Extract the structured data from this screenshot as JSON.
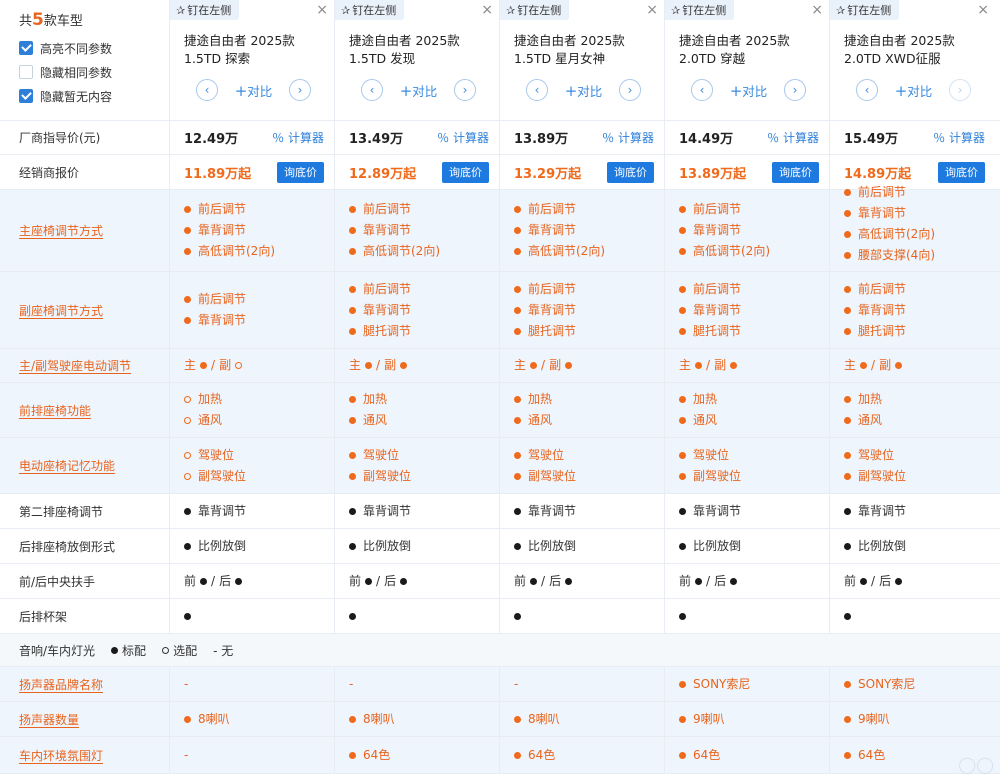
{
  "header": {
    "count_prefix": "共",
    "count": "5",
    "count_suffix": "款车型",
    "options": [
      {
        "label": "高亮不同参数",
        "checked": true
      },
      {
        "label": "隐藏相同参数",
        "checked": false
      },
      {
        "label": "隐藏暂无内容",
        "checked": true
      }
    ],
    "pin_label": "钉在左侧",
    "close_glyph": "×",
    "compare_label": "对比",
    "prev_glyph": "‹",
    "next_glyph": "›",
    "cars": [
      {
        "line1": "捷途自由者 2025款",
        "line2": "1.5TD 探索",
        "guide_price": "12.49万",
        "dealer_price": "11.89万起"
      },
      {
        "line1": "捷途自由者 2025款",
        "line2": "1.5TD 发现",
        "guide_price": "13.49万",
        "dealer_price": "12.89万起"
      },
      {
        "line1": "捷途自由者 2025款",
        "line2": "1.5TD 星月女神",
        "guide_price": "13.89万",
        "dealer_price": "13.29万起"
      },
      {
        "line1": "捷途自由者 2025款",
        "line2": "2.0TD 穿越",
        "guide_price": "14.49万",
        "dealer_price": "13.89万起"
      },
      {
        "line1": "捷途自由者 2025款",
        "line2": "2.0TD XWD征服",
        "guide_price": "15.49万",
        "dealer_price": "14.89万起"
      }
    ]
  },
  "labels": {
    "guide_price": "厂商指导价(元)",
    "dealer_price": "经销商报价",
    "calculator": "计算器",
    "ask_price": "询底价"
  },
  "rows": [
    {
      "label": "主座椅调节方式",
      "diff": true,
      "cells": [
        [
          {
            "m": "fo",
            "t": "前后调节"
          },
          {
            "m": "fo",
            "t": "靠背调节"
          },
          {
            "m": "fo",
            "t": "高低调节(2向)"
          }
        ],
        [
          {
            "m": "fo",
            "t": "前后调节"
          },
          {
            "m": "fo",
            "t": "靠背调节"
          },
          {
            "m": "fo",
            "t": "高低调节(2向)"
          }
        ],
        [
          {
            "m": "fo",
            "t": "前后调节"
          },
          {
            "m": "fo",
            "t": "靠背调节"
          },
          {
            "m": "fo",
            "t": "高低调节(2向)"
          }
        ],
        [
          {
            "m": "fo",
            "t": "前后调节"
          },
          {
            "m": "fo",
            "t": "靠背调节"
          },
          {
            "m": "fo",
            "t": "高低调节(2向)"
          }
        ],
        [
          {
            "m": "fo",
            "t": "前后调节"
          },
          {
            "m": "fo",
            "t": "靠背调节"
          },
          {
            "m": "fo",
            "t": "高低调节(2向)"
          },
          {
            "m": "fo",
            "t": "腰部支撑(4向)"
          }
        ]
      ]
    },
    {
      "label": "副座椅调节方式",
      "diff": true,
      "cells": [
        [
          {
            "m": "fo",
            "t": "前后调节"
          },
          {
            "m": "fo",
            "t": "靠背调节"
          }
        ],
        [
          {
            "m": "fo",
            "t": "前后调节"
          },
          {
            "m": "fo",
            "t": "靠背调节"
          },
          {
            "m": "fo",
            "t": "腿托调节"
          }
        ],
        [
          {
            "m": "fo",
            "t": "前后调节"
          },
          {
            "m": "fo",
            "t": "靠背调节"
          },
          {
            "m": "fo",
            "t": "腿托调节"
          }
        ],
        [
          {
            "m": "fo",
            "t": "前后调节"
          },
          {
            "m": "fo",
            "t": "靠背调节"
          },
          {
            "m": "fo",
            "t": "腿托调节"
          }
        ],
        [
          {
            "m": "fo",
            "t": "前后调节"
          },
          {
            "m": "fo",
            "t": "靠背调节"
          },
          {
            "m": "fo",
            "t": "腿托调节"
          }
        ]
      ]
    },
    {
      "label": "主/副驾驶座电动调节",
      "diff": true,
      "inline": true,
      "cells": [
        {
          "a": "主",
          "am": "fo",
          "b": "副",
          "bm": "ho"
        },
        {
          "a": "主",
          "am": "fo",
          "b": "副",
          "bm": "fo"
        },
        {
          "a": "主",
          "am": "fo",
          "b": "副",
          "bm": "fo"
        },
        {
          "a": "主",
          "am": "fo",
          "b": "副",
          "bm": "fo"
        },
        {
          "a": "主",
          "am": "fo",
          "b": "副",
          "bm": "fo"
        }
      ]
    },
    {
      "label": "前排座椅功能",
      "diff": true,
      "cells": [
        [
          {
            "m": "ho",
            "t": "加热"
          },
          {
            "m": "ho",
            "t": "通风"
          }
        ],
        [
          {
            "m": "fo",
            "t": "加热"
          },
          {
            "m": "fo",
            "t": "通风"
          }
        ],
        [
          {
            "m": "fo",
            "t": "加热"
          },
          {
            "m": "fo",
            "t": "通风"
          }
        ],
        [
          {
            "m": "fo",
            "t": "加热"
          },
          {
            "m": "fo",
            "t": "通风"
          }
        ],
        [
          {
            "m": "fo",
            "t": "加热"
          },
          {
            "m": "fo",
            "t": "通风"
          }
        ]
      ]
    },
    {
      "label": "电动座椅记忆功能",
      "diff": true,
      "cells": [
        [
          {
            "m": "ho",
            "t": "驾驶位"
          },
          {
            "m": "ho",
            "t": "副驾驶位"
          }
        ],
        [
          {
            "m": "fo",
            "t": "驾驶位"
          },
          {
            "m": "fo",
            "t": "副驾驶位"
          }
        ],
        [
          {
            "m": "fo",
            "t": "驾驶位"
          },
          {
            "m": "fo",
            "t": "副驾驶位"
          }
        ],
        [
          {
            "m": "fo",
            "t": "驾驶位"
          },
          {
            "m": "fo",
            "t": "副驾驶位"
          }
        ],
        [
          {
            "m": "fo",
            "t": "驾驶位"
          },
          {
            "m": "fo",
            "t": "副驾驶位"
          }
        ]
      ]
    },
    {
      "label": "第二排座椅调节",
      "diff": false,
      "cells": [
        [
          {
            "m": "fd",
            "t": "靠背调节"
          }
        ],
        [
          {
            "m": "fd",
            "t": "靠背调节"
          }
        ],
        [
          {
            "m": "fd",
            "t": "靠背调节"
          }
        ],
        [
          {
            "m": "fd",
            "t": "靠背调节"
          }
        ],
        [
          {
            "m": "fd",
            "t": "靠背调节"
          }
        ]
      ]
    },
    {
      "label": "后排座椅放倒形式",
      "diff": false,
      "cells": [
        [
          {
            "m": "fd",
            "t": "比例放倒"
          }
        ],
        [
          {
            "m": "fd",
            "t": "比例放倒"
          }
        ],
        [
          {
            "m": "fd",
            "t": "比例放倒"
          }
        ],
        [
          {
            "m": "fd",
            "t": "比例放倒"
          }
        ],
        [
          {
            "m": "fd",
            "t": "比例放倒"
          }
        ]
      ]
    },
    {
      "label": "前/后中央扶手",
      "diff": false,
      "inline": true,
      "cells": [
        {
          "a": "前",
          "am": "fd",
          "b": "后",
          "bm": "fd"
        },
        {
          "a": "前",
          "am": "fd",
          "b": "后",
          "bm": "fd"
        },
        {
          "a": "前",
          "am": "fd",
          "b": "后",
          "bm": "fd"
        },
        {
          "a": "前",
          "am": "fd",
          "b": "后",
          "bm": "fd"
        },
        {
          "a": "前",
          "am": "fd",
          "b": "后",
          "bm": "fd"
        }
      ]
    },
    {
      "label": "后排杯架",
      "diff": false,
      "cells": [
        [
          {
            "m": "fd",
            "t": ""
          }
        ],
        [
          {
            "m": "fd",
            "t": ""
          }
        ],
        [
          {
            "m": "fd",
            "t": ""
          }
        ],
        [
          {
            "m": "fd",
            "t": ""
          }
        ],
        [
          {
            "m": "fd",
            "t": ""
          }
        ]
      ]
    }
  ],
  "section": {
    "title": "音响/车内灯光",
    "legend_standard": "标配",
    "legend_optional": "选配",
    "legend_none": "- 无"
  },
  "rows2": [
    {
      "label": "扬声器品牌名称",
      "diff": true,
      "cells": [
        [
          {
            "m": "dash",
            "t": "-"
          }
        ],
        [
          {
            "m": "dash",
            "t": "-"
          }
        ],
        [
          {
            "m": "dash",
            "t": "-"
          }
        ],
        [
          {
            "m": "fo",
            "t": "SONY索尼"
          }
        ],
        [
          {
            "m": "fo",
            "t": "SONY索尼"
          }
        ]
      ]
    },
    {
      "label": "扬声器数量",
      "diff": true,
      "cells": [
        [
          {
            "m": "fo",
            "t": "8喇叭"
          }
        ],
        [
          {
            "m": "fo",
            "t": "8喇叭"
          }
        ],
        [
          {
            "m": "fo",
            "t": "8喇叭"
          }
        ],
        [
          {
            "m": "fo",
            "t": "9喇叭"
          }
        ],
        [
          {
            "m": "fo",
            "t": "9喇叭"
          }
        ]
      ]
    },
    {
      "label": "车内环境氛围灯",
      "diff": true,
      "cells": [
        [
          {
            "m": "dash",
            "t": "-"
          }
        ],
        [
          {
            "m": "fo",
            "t": "64色"
          }
        ],
        [
          {
            "m": "fo",
            "t": "64色"
          }
        ],
        [
          {
            "m": "fo",
            "t": "64色"
          }
        ],
        [
          {
            "m": "fo",
            "t": "64色"
          }
        ]
      ]
    }
  ],
  "colors": {
    "accent_orange": "#f06a1c",
    "accent_blue": "#1f7ae0",
    "highlight_bg": "#eef5fc"
  }
}
